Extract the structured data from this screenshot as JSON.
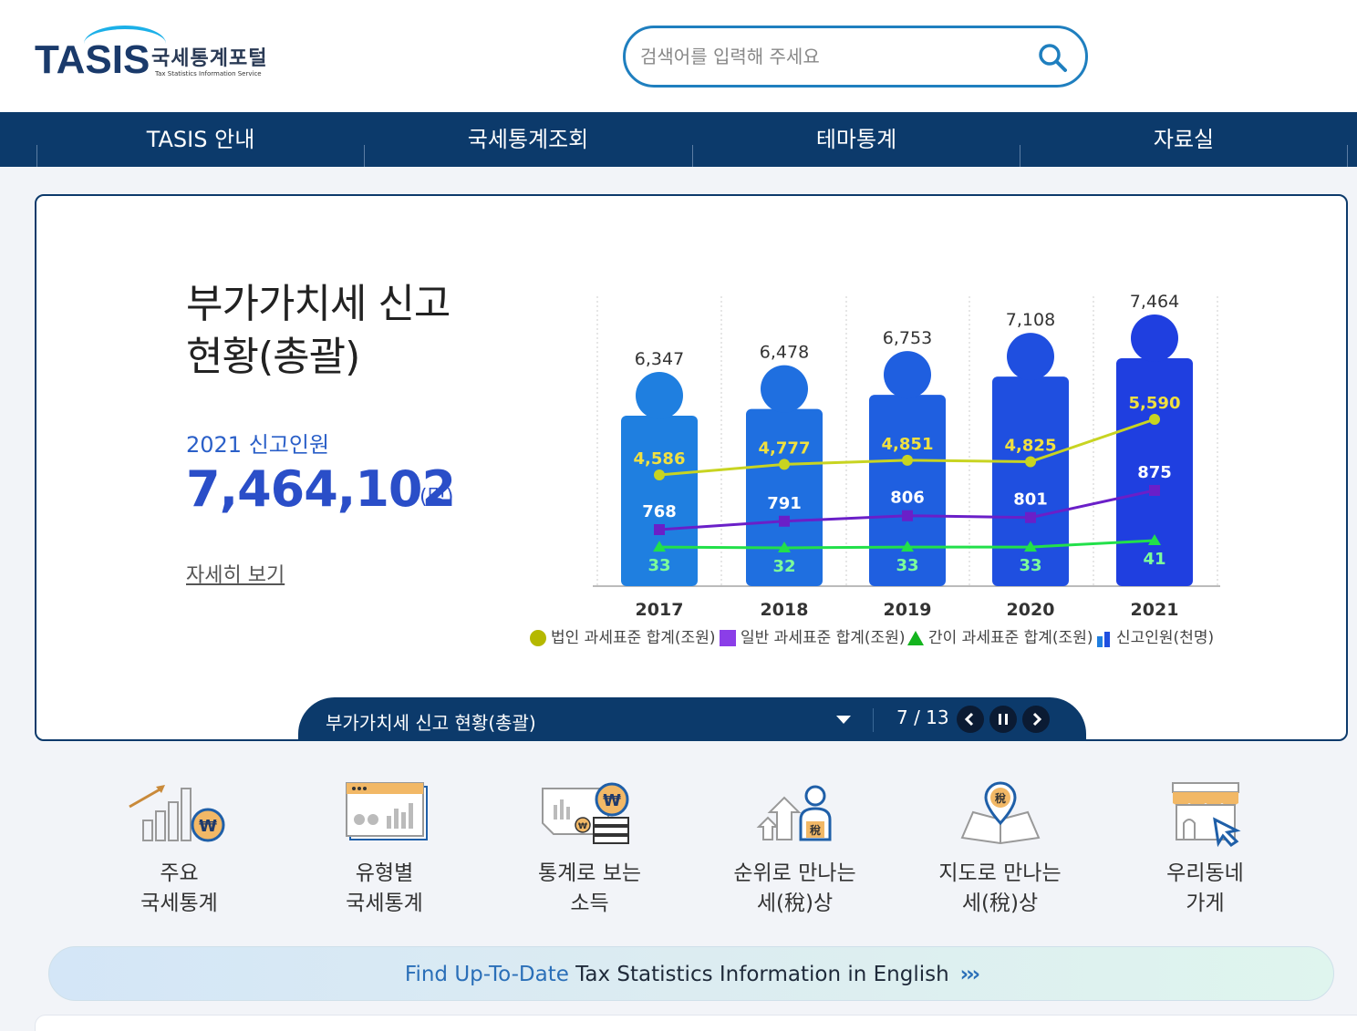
{
  "header": {
    "logo_text": "TASIS",
    "logo_kr": "국세통계포털",
    "logo_en": "Tax Statistics Information Service",
    "search_placeholder": "검색어를 입력해 주세요"
  },
  "nav": {
    "items": [
      "TASIS 안내",
      "국세통계조회",
      "테마통계",
      "자료실"
    ]
  },
  "banner": {
    "title_line1": "부가가치세 신고",
    "title_line2": "현황(총괄)",
    "subtitle": "2021 신고인원",
    "value": "7,464,102",
    "unit": "(명)",
    "more_link": "자세히 보기"
  },
  "chart_data": {
    "type": "bar",
    "categories": [
      "2017",
      "2018",
      "2019",
      "2020",
      "2021"
    ],
    "series": [
      {
        "name": "신고인원(천명)",
        "kind": "bar",
        "values": [
          6347,
          6478,
          6753,
          7108,
          7464
        ],
        "labels": [
          "6,347",
          "6,478",
          "6,753",
          "7,108",
          "7,464"
        ]
      },
      {
        "name": "법인 과세표준 합계(조원)",
        "kind": "line",
        "values": [
          4586,
          4777,
          4851,
          4825,
          5590
        ],
        "labels": [
          "4,586",
          "4,777",
          "4,851",
          "4,825",
          "5,590"
        ]
      },
      {
        "name": "일반 과세표준 합계(조원)",
        "kind": "line",
        "values": [
          768,
          791,
          806,
          801,
          875
        ],
        "labels": [
          "768",
          "791",
          "806",
          "801",
          "875"
        ]
      },
      {
        "name": "간이 과세표준 합계(조원)",
        "kind": "line",
        "values": [
          33,
          32,
          33,
          33,
          41
        ],
        "labels": [
          "33",
          "32",
          "33",
          "33",
          "41"
        ]
      }
    ],
    "colors": {
      "bars": [
        "#1f7fe0",
        "#1f6fe0",
        "#1f5fe0",
        "#1f4fe0",
        "#1f3fe0"
      ],
      "corp": "#c8d421",
      "general": "#6a1fc8",
      "simple": "#22e04a"
    }
  },
  "slider": {
    "title": "부가가치세 신고 현황(총괄)",
    "count": "7 / 13"
  },
  "quick_menu": [
    {
      "line1": "주요",
      "line2": "국세통계"
    },
    {
      "line1": "유형별",
      "line2": "국세통계"
    },
    {
      "line1": "통계로 보는",
      "line2": "소득"
    },
    {
      "line1": "순위로 만나는",
      "line2": "세(稅)상"
    },
    {
      "line1": "지도로 만나는",
      "line2": "세(稅)상"
    },
    {
      "line1": "우리동네",
      "line2": "가게"
    }
  ],
  "english_bar": {
    "highlight": "Find Up-To-Date",
    "text": " Tax Statistics Information in English",
    "arrows": "›››"
  }
}
